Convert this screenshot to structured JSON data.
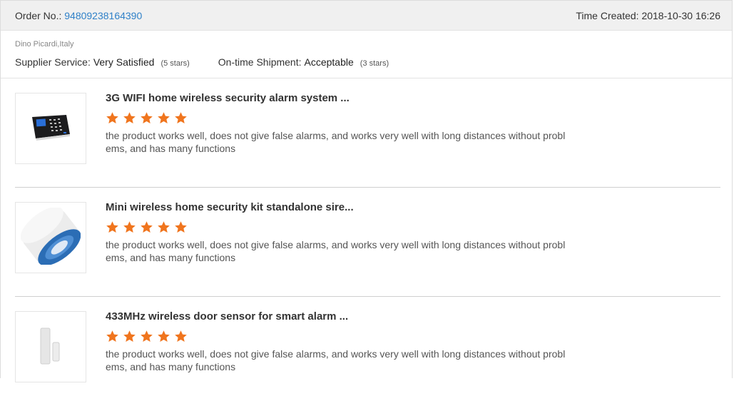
{
  "order": {
    "label": "Order No.:",
    "number": "94809238164390",
    "time_label": "Time Created:",
    "time_value": "2018-10-30 16:26"
  },
  "buyer": {
    "name": "Dino Picardi,Italy",
    "supplier_label": "Supplier Service:",
    "supplier_value": "Very Satisfied",
    "supplier_stars": "(5 stars)",
    "shipment_label": "On-time Shipment:",
    "shipment_value": "Acceptable",
    "shipment_stars": "(3 stars)"
  },
  "colors": {
    "star": "#f0751e",
    "link": "#2f80c8"
  },
  "products": [
    {
      "title": "3G WIFI home wireless security alarm system ...",
      "rating": 5,
      "comment": "the product works well, does not give false alarms, and works very well with long distances without problems, and has many functions",
      "image_icon": "alarm-panel-icon"
    },
    {
      "title": "Mini wireless home security kit standalone sire...",
      "rating": 5,
      "comment": "the product works well, does not give false alarms, and works very well with long distances without problems, and has many functions",
      "image_icon": "siren-icon"
    },
    {
      "title": "433MHz wireless door sensor for smart alarm ...",
      "rating": 5,
      "comment": "the product works well, does not give false alarms, and works very well with long distances without problems, and has many functions",
      "image_icon": "door-sensor-icon"
    }
  ]
}
